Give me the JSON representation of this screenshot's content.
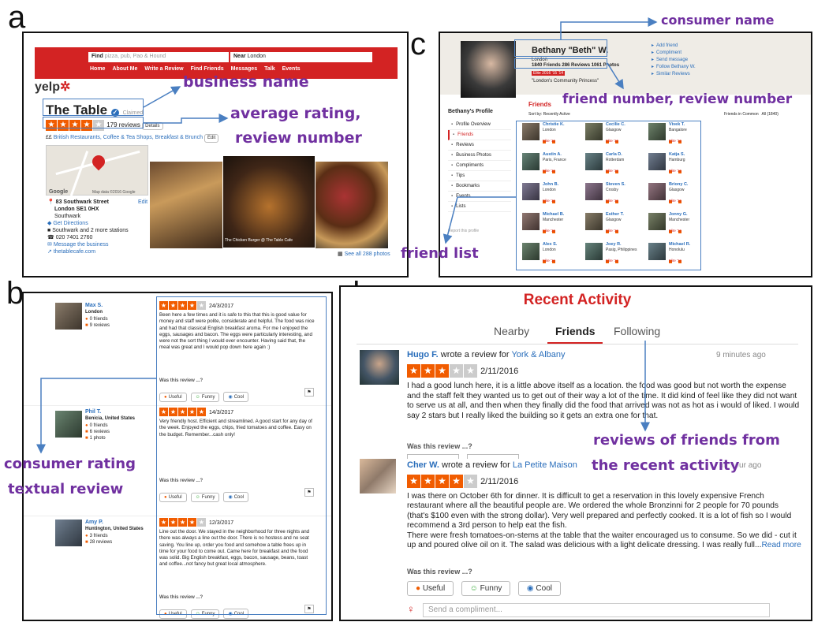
{
  "labels": {
    "a": "a",
    "b": "b",
    "c": "c",
    "d": "d"
  },
  "annotations": {
    "business_name": "business name",
    "average_rating_1": "average rating,",
    "average_rating_2": "review number",
    "consumer_name": "consumer name",
    "friend_numbers": "friend number, review number",
    "friend_list": "friend list",
    "consumer_rating_1": "consumer rating",
    "consumer_rating_2": "textual review",
    "reviews_friends_1": "reviews of friends from",
    "reviews_friends_2": "the recent activity"
  },
  "panel_a": {
    "find_label": "Find",
    "find_placeholder": "pizza, pub, Pao & Hound",
    "near_label": "Near",
    "near_value": "London",
    "nav": [
      "Home",
      "About Me",
      "Write a Review",
      "Find Friends",
      "Messages",
      "Talk",
      "Events"
    ],
    "logo": "yelp",
    "business_name": "The Table",
    "claimed": "Claimed",
    "review_count": "179 reviews",
    "details": "Details",
    "price": "££",
    "categories": "British Restaurants, Coffee & Tea Shops, Breakfast & Brunch",
    "edit": "Edit",
    "map_brand": "Google",
    "map_data": "Map data ©2016 Google",
    "address": [
      "83 Southwark Street",
      "London SE1 0HX",
      "Southwark"
    ],
    "directions": "Get Directions",
    "station": "Southwark and 2 more stations",
    "phone": "020 7401 2760",
    "message": "Message the business",
    "website": "thetablecafe.com",
    "photo_caption": "The Chicken Burger @ The Table Cafe",
    "see_all": "See all 288 photos"
  },
  "panel_b": {
    "reviews": [
      {
        "name": "Max S.",
        "loc": "London",
        "friends": "0 friends",
        "reviews": "9 reviews",
        "photos": "",
        "date": "24/3/2017",
        "stars": 4,
        "text": "Been here a few times and it is safe to this that this is good value for money and staff were polite, considerate and helpful. The food was nice and had that classical English breakfast aroma. For me I enjoyed the eggs, sausages and bacon. The eggs were particularly interesting, and were not the sort thing I would ever encounter. Having said that, the meal was great and I would pop down here again :)"
      },
      {
        "name": "Phil T.",
        "loc": "Benicia, United States",
        "friends": "0 friends",
        "reviews": "6 reviews",
        "photos": "1 photo",
        "date": "14/3/2017",
        "stars": 5,
        "text": "Very friendly host. Efficient and streamlined. A good start for any day of the week. Enjoyed the eggs, chips, fried tomatoes and coffee. Easy on the budget. Remember...cash only!"
      },
      {
        "name": "Amy P.",
        "loc": "Huntington, United States",
        "friends": "3 friends",
        "reviews": "28 reviews",
        "photos": "",
        "date": "12/3/2017",
        "stars": 4,
        "text": "Line out the door. We stayed in the neighborhood for three nights and there was always a line out the door. There is no hostess and no seat saving. You line up, order you food and somehow a table frees up in time for your food to come out. Came here for breakfast and the food was solid. Big English breakfast, eggs, bacon, sausage, beans, toast and coffee...not fancy but great local atmosphere."
      }
    ],
    "was_helpful": "Was this review ...?",
    "useful": "Useful",
    "funny": "Funny",
    "cool": "Cool"
  },
  "panel_c": {
    "name": "Bethany \"Beth\" W.",
    "city": "London",
    "stats": "1840 Friends  286 Reviews  1061 Photos",
    "elite": "Elite 2016  '15  '14",
    "quote": "\"London's Community Princess\"",
    "actions": [
      "Add friend",
      "Compliment",
      "Send message",
      "Follow Bethany W.",
      "Similar Reviews"
    ],
    "profile_title": "Bethany's Profile",
    "menu": [
      "Profile Overview",
      "Friends",
      "Reviews",
      "Business Photos",
      "Compliments",
      "Tips",
      "Bookmarks",
      "Events",
      "Lists"
    ],
    "report": "Report this profile",
    "friends_title": "Friends",
    "sort": "Sort by: Recently Active",
    "tabs": "Friends in Common   All (1840)",
    "friends": [
      {
        "name": "Christie K.",
        "loc": "London"
      },
      {
        "name": "Cecilie C.",
        "loc": "Glasgow"
      },
      {
        "name": "Vivek T.",
        "loc": "Bangalore"
      },
      {
        "name": "Austin A.",
        "loc": "Paris, France"
      },
      {
        "name": "Carla D.",
        "loc": "Rotterdam"
      },
      {
        "name": "Katja S.",
        "loc": "Hamburg"
      },
      {
        "name": "John B.",
        "loc": "London"
      },
      {
        "name": "Steven S.",
        "loc": "Crosby"
      },
      {
        "name": "Briony C.",
        "loc": "Glasgow"
      },
      {
        "name": "Michael B.",
        "loc": "Manchester"
      },
      {
        "name": "Esther T.",
        "loc": "Glasgow"
      },
      {
        "name": "Jonny G.",
        "loc": "Manchester"
      },
      {
        "name": "Alex S.",
        "loc": "London"
      },
      {
        "name": "Joey R.",
        "loc": "Pasig, Philippines"
      },
      {
        "name": "Michael R.",
        "loc": "Honolulu"
      }
    ],
    "elite_tag": "Elite '16"
  },
  "panel_d": {
    "title": "Recent Activity",
    "tabs": [
      "Nearby",
      "Friends",
      "Following"
    ],
    "items": [
      {
        "user": "Hugo F.",
        "verb": "wrote a review for",
        "biz": "York & Albany",
        "time": "9 minutes ago",
        "stars": 3,
        "date": "2/11/2016",
        "text": "I had a good lunch here, it is a little above itself as a location. the food was good but not worth the expense and the staff felt they wanted us to get out of their way a lot of the time. It did kind of feel like they did not want to serve us at all, and then when they finally did the food that arrived was not as hot as i would of liked. I would say 2 stars but I really liked the building so it gets an extra one for that."
      },
      {
        "user": "Cher W.",
        "verb": "wrote a review for",
        "biz": "La Petite Maison",
        "time": "an hour ago",
        "stars": 4,
        "date": "2/11/2016",
        "text": "I was there on October 6th for dinner.  It is difficult to get a reservation in this lovely expensive French restaurant where all the beautiful people are. We ordered the whole Bronzinni for 2 people for 70 pounds (that's $100 even with the strong dollar).  Very well prepared and perfectly cooked.  It is a lot of fish so I would recommend a 3rd person to help eat the fish.\nThere were fresh tomatoes-on-stems at the table that the waiter encouraged us to consume.  So we did - cut it up and poured olive oil on it.  The salad was delicious with a light delicate dressing. I was really full...",
        "read_more": "Read more"
      }
    ],
    "was_helpful": "Was this review ...?",
    "useful": "Useful",
    "funny": "Funny",
    "cool": "Cool",
    "compliment_placeholder": "Send a compliment..."
  },
  "colors": {
    "yelp_red": "#d32323",
    "annotation": "#7030a0",
    "link_blue": "#2a6ebb",
    "annotation_line": "#4a7fc1",
    "star_orange": "#f15c00"
  }
}
